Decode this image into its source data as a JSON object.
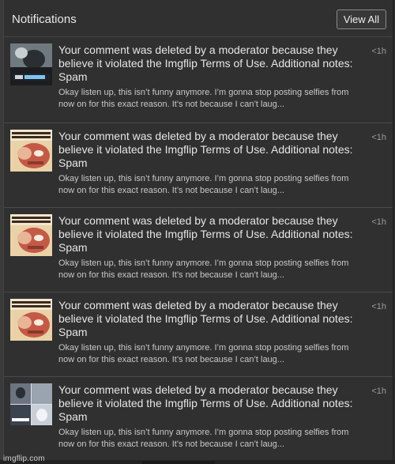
{
  "header": {
    "title": "Notifications",
    "view_all_label": "View All"
  },
  "notifications": [
    {
      "thumb_icon": "meme-thumbnail-icon",
      "message": "Your comment was deleted by a moderator because they believe it violated the Imgflip Terms of Use. Additional notes: Spam",
      "preview": "Okay listen up, this isn’t funny anymore. I’m gonna stop posting selfies from now on for this exact reason. It’s not because I can’t laug...",
      "time": "<1h"
    },
    {
      "thumb_icon": "meme-thumbnail-icon",
      "message": "Your comment was deleted by a moderator because they believe it violated the Imgflip Terms of Use. Additional notes: Spam",
      "preview": "Okay listen up, this isn’t funny anymore. I’m gonna stop posting selfies from now on for this exact reason. It’s not because I can’t laug...",
      "time": "<1h"
    },
    {
      "thumb_icon": "meme-thumbnail-icon",
      "message": "Your comment was deleted by a moderator because they believe it violated the Imgflip Terms of Use. Additional notes: Spam",
      "preview": "Okay listen up, this isn’t funny anymore. I’m gonna stop posting selfies from now on for this exact reason. It’s not because I can’t laug...",
      "time": "<1h"
    },
    {
      "thumb_icon": "meme-thumbnail-icon",
      "message": "Your comment was deleted by a moderator because they believe it violated the Imgflip Terms of Use. Additional notes: Spam",
      "preview": "Okay listen up, this isn’t funny anymore. I’m gonna stop posting selfies from now on for this exact reason. It’s not because I can’t laug...",
      "time": "<1h"
    },
    {
      "thumb_icon": "meme-thumbnail-icon",
      "message": "Your comment was deleted by a moderator because they believe it violated the Imgflip Terms of Use. Additional notes: Spam",
      "preview": "Okay listen up, this isn’t funny anymore. I’m gonna stop posting selfies from now on for this exact reason. It’s not because I can’t laug...",
      "time": "<1h"
    }
  ],
  "watermark": "imgflip.com",
  "colors": {
    "panel_bg": "#303030",
    "text_primary": "#e6e6e6",
    "text_secondary": "#c8c8c8",
    "time_text": "#9a9a9a"
  }
}
